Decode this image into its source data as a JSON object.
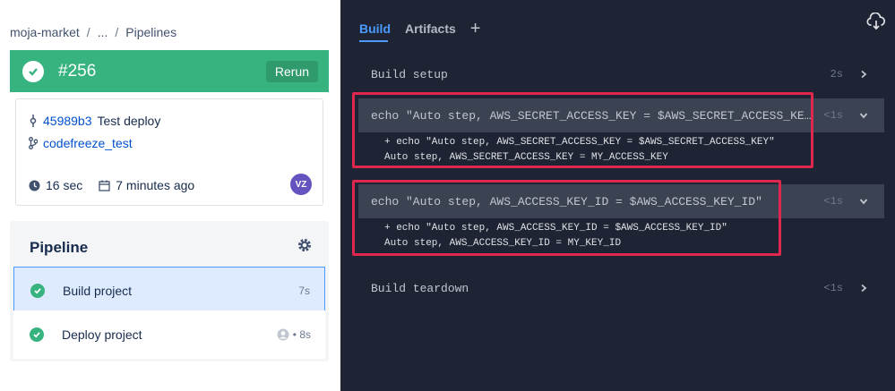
{
  "breadcrumb": {
    "repo": "moja-market",
    "ellipsis": "...",
    "page": "Pipelines"
  },
  "build": {
    "number": "#256",
    "rerun_label": "Rerun",
    "status_color": "#36b37e"
  },
  "commit": {
    "hash": "45989b3",
    "message": "Test deploy",
    "branch": "codefreeze_test",
    "duration": "16 sec",
    "time_ago": "7 minutes ago",
    "avatar_initials": "VZ"
  },
  "pipeline": {
    "title": "Pipeline",
    "steps": [
      {
        "label": "Build project",
        "duration": "7s"
      },
      {
        "label": "Deploy project",
        "duration": "• 8s"
      }
    ]
  },
  "log": {
    "tabs": {
      "build": "Build",
      "artifacts": "Artifacts",
      "add": "+"
    },
    "rows": [
      {
        "cmd": "Build setup",
        "time": "2s"
      },
      {
        "cmd": "echo \"Auto step, AWS_SECRET_ACCESS_KEY = $AWS_SECRET_ACCESS_KE…",
        "time": "<1s",
        "out1": "+ echo \"Auto step, AWS_SECRET_ACCESS_KEY = $AWS_SECRET_ACCESS_KEY\"",
        "out2": "Auto step, AWS_SECRET_ACCESS_KEY = MY_ACCESS_KEY"
      },
      {
        "cmd": "echo \"Auto step, AWS_ACCESS_KEY_ID = $AWS_ACCESS_KEY_ID\"",
        "time": "<1s",
        "out1": "+ echo \"Auto step, AWS_ACCESS_KEY_ID = $AWS_ACCESS_KEY_ID\"",
        "out2": "Auto step, AWS_ACCESS_KEY_ID = MY_KEY_ID"
      },
      {
        "cmd": "Build teardown",
        "time": "<1s"
      }
    ]
  },
  "colors": {
    "accent": "#4c9aff",
    "highlight": "#e0284f",
    "log_bg": "#1e2433"
  },
  "icons": [
    "check-icon",
    "commit-icon",
    "branch-icon",
    "clock-icon",
    "calendar-icon",
    "gear-icon",
    "cloud-download-icon",
    "chevron-right-icon",
    "chevron-down-icon",
    "user-icon"
  ]
}
